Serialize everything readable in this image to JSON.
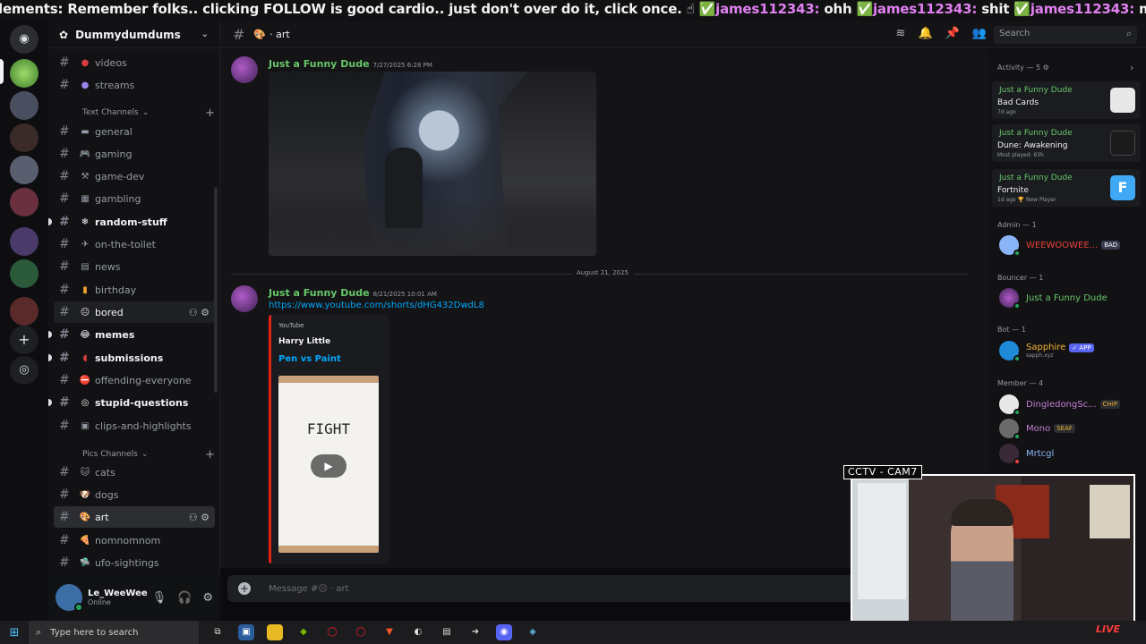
{
  "ticker": {
    "parts": [
      {
        "text": "lements: ",
        "pink": false
      },
      {
        "text": "Remember folks.. clicking FOLLOW is good cardio.. just don't over do it, click once. ☝ ✅",
        "pink": false
      },
      {
        "text": "james112343: ",
        "pink": true
      },
      {
        "text": "ohh ✅",
        "pink": false
      },
      {
        "text": "james112343: ",
        "pink": true
      },
      {
        "text": "shit ✅",
        "pink": false
      },
      {
        "text": "james112343: ",
        "pink": true
      },
      {
        "text": "mbmb",
        "pink": false
      }
    ]
  },
  "server": {
    "name": "Dummydumdums"
  },
  "categories": {
    "text": "Text Channels",
    "pics": "Pics Channels"
  },
  "channels": [
    {
      "name": "videos",
      "emoji": "●",
      "color": "#d83c3e"
    },
    {
      "name": "streams",
      "emoji": "●",
      "color": "#9b84ec"
    },
    {
      "name": "general",
      "emoji": "▬"
    },
    {
      "name": "gaming",
      "emoji": "🎮"
    },
    {
      "name": "game-dev",
      "emoji": "⚒"
    },
    {
      "name": "gambling",
      "emoji": "▦"
    },
    {
      "name": "random-stuff",
      "emoji": "❄"
    },
    {
      "name": "on-the-toilet",
      "emoji": "✈"
    },
    {
      "name": "news",
      "emoji": "▤"
    },
    {
      "name": "birthday",
      "emoji": "▮"
    },
    {
      "name": "bored",
      "emoji": "😐"
    },
    {
      "name": "memes",
      "emoji": "😂"
    },
    {
      "name": "submissions",
      "emoji": "◖"
    },
    {
      "name": "offending-everyone",
      "emoji": "⛔"
    },
    {
      "name": "stupid-questions",
      "emoji": "◎"
    },
    {
      "name": "clips-and-highlights",
      "emoji": "▣"
    },
    {
      "name": "cats",
      "emoji": "🐱"
    },
    {
      "name": "dogs",
      "emoji": "🐶"
    },
    {
      "name": "art",
      "emoji": "🎨"
    },
    {
      "name": "nomnomnom",
      "emoji": "🍕"
    },
    {
      "name": "ufo-sightings",
      "emoji": "🛸"
    }
  ],
  "user": {
    "name": "Le_WeeWee",
    "status": "Online"
  },
  "header": {
    "channel": "· art",
    "search_placeholder": "Search"
  },
  "messages": [
    {
      "author": "Just a Funny Dude",
      "time": "7/27/2025 6:28 PM"
    },
    {
      "author": "Just a Funny Dude",
      "time": "8/21/2025 10:01 AM",
      "link": "https://www.youtube.com/shorts/dHG432DwdL8",
      "embed": {
        "provider": "YouTube",
        "author": "Harry Little",
        "title": "Pen vs Paint",
        "thumb_text": "FIGHT"
      }
    }
  ],
  "date_divider": "August 21, 2025",
  "composer": {
    "placeholder": "Message #😐 · art"
  },
  "activity": {
    "header": "Activity — 5 ⚙",
    "cards": [
      {
        "who": "Just a Funny Dude",
        "game": "Bad Cards",
        "sub": "7d ago",
        "color": "#e8e8e8"
      },
      {
        "who": "Just a Funny Dude",
        "game": "Dune: Awakening",
        "sub": "Most played: 63h",
        "color": "#1b1b1b"
      },
      {
        "who": "Just a Funny Dude",
        "game": "Fortnite",
        "sub": "1d ago  🏆 New Player",
        "color": "#3fa9f5"
      }
    ]
  },
  "roles": {
    "admin": "Admin — 1",
    "bouncer": "Bouncer — 1",
    "bot": "Bot — 1",
    "member": "Member — 4"
  },
  "members": {
    "admin": {
      "name": "WEEWOOWEE...",
      "tag": "BAD",
      "color": "#e8413c"
    },
    "bouncer": {
      "name": "Just a Funny Dude",
      "color": "#67c76b"
    },
    "bot": {
      "name": "Sapphire",
      "tag": "✓ APP",
      "sub": "sapph.xyz",
      "color": "#f0b232"
    },
    "m1": {
      "name": "DingledongSc...",
      "tag": "CHIP",
      "color": "#c27cd6"
    },
    "m2": {
      "name": "Mono",
      "tag": "SEAF",
      "color": "#c27cd6"
    },
    "m3": {
      "name": "Mrtcgl",
      "color": "#8ab4f8"
    }
  },
  "webcam": {
    "label": "CCTV - CAM7",
    "live": "LIVE"
  },
  "taskbar": {
    "search": "Type here to search"
  }
}
